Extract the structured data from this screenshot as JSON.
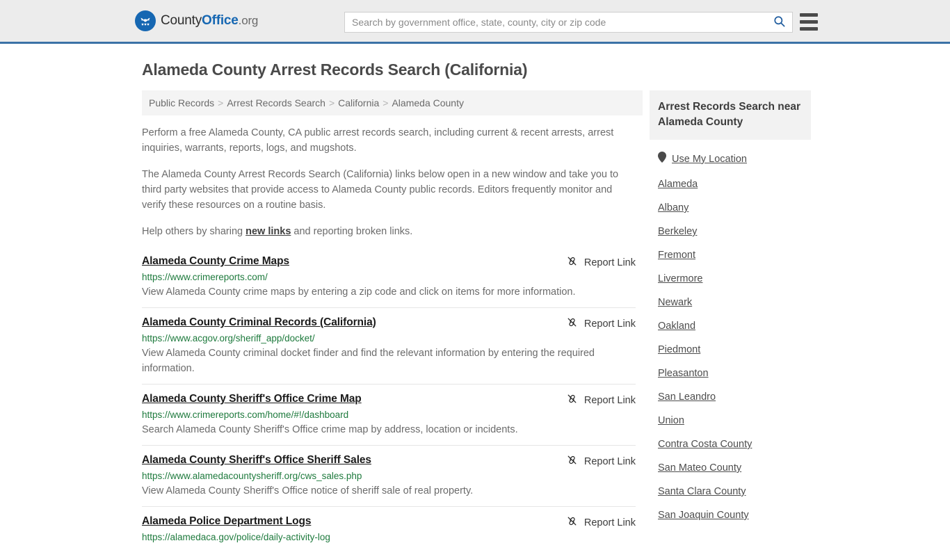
{
  "header": {
    "brand": {
      "part1": "County",
      "part2": "Office",
      "part3": ".org",
      "logo_icon": "eagle-stars-logo"
    },
    "search": {
      "placeholder": "Search by government office, state, county, city or zip code",
      "value": "",
      "search_icon": "search-icon"
    },
    "menu_icon": "hamburger-menu-icon"
  },
  "page": {
    "title": "Alameda County Arrest Records Search (California)",
    "breadcrumb": [
      {
        "label": "Public Records"
      },
      {
        "label": "Arrest Records Search"
      },
      {
        "label": "California"
      },
      {
        "label": "Alameda County"
      }
    ],
    "breadcrumb_separator": ">",
    "intro": {
      "p1": "Perform a free Alameda County, CA public arrest records search, including current & recent arrests, arrest inquiries, warrants, reports, logs, and mugshots.",
      "p2": "The Alameda County Arrest Records Search (California) links below open in a new window and take you to third party websites that provide access to Alameda County public records. Editors frequently monitor and verify these resources on a routine basis.",
      "p3_before": "Help others by sharing ",
      "p3_link": "new links",
      "p3_after": " and reporting broken links."
    }
  },
  "results": {
    "report_label": "Report Link",
    "report_icon": "broken-link-icon",
    "items": [
      {
        "title": "Alameda County Crime Maps",
        "url": "https://www.crimereports.com/",
        "description": "View Alameda County crime maps by entering a zip code and click on items for more information."
      },
      {
        "title": "Alameda County Criminal Records (California)",
        "url": "https://www.acgov.org/sheriff_app/docket/",
        "description": "View Alameda County criminal docket finder and find the relevant information by entering the required information."
      },
      {
        "title": "Alameda County Sheriff's Office Crime Map",
        "url": "https://www.crimereports.com/home/#!/dashboard",
        "description": "Search Alameda County Sheriff's Office crime map by address, location or incidents."
      },
      {
        "title": "Alameda County Sheriff's Office Sheriff Sales",
        "url": "https://www.alamedacountysheriff.org/cws_sales.php",
        "description": "View Alameda County Sheriff's Office notice of sheriff sale of real property."
      },
      {
        "title": "Alameda Police Department Logs",
        "url": "https://alamedaca.gov/police/daily-activity-log",
        "description": ""
      }
    ]
  },
  "sidebar": {
    "heading": "Arrest Records Search near Alameda County",
    "use_my_location": {
      "label": "Use My Location",
      "icon": "map-pin-icon"
    },
    "links": [
      {
        "label": "Alameda"
      },
      {
        "label": "Albany"
      },
      {
        "label": "Berkeley"
      },
      {
        "label": "Fremont"
      },
      {
        "label": "Livermore"
      },
      {
        "label": "Newark"
      },
      {
        "label": "Oakland"
      },
      {
        "label": "Piedmont"
      },
      {
        "label": "Pleasanton"
      },
      {
        "label": "San Leandro"
      },
      {
        "label": "Union"
      },
      {
        "label": "Contra Costa County"
      },
      {
        "label": "San Mateo County"
      },
      {
        "label": "Santa Clara County"
      },
      {
        "label": "San Joaquin County"
      }
    ]
  },
  "colors": {
    "header_bg": "#ececec",
    "header_border": "#3b72a6",
    "brand_blue": "#1667b2",
    "url_green": "#1e7a3d",
    "panel_gray": "#f2f2f2"
  }
}
